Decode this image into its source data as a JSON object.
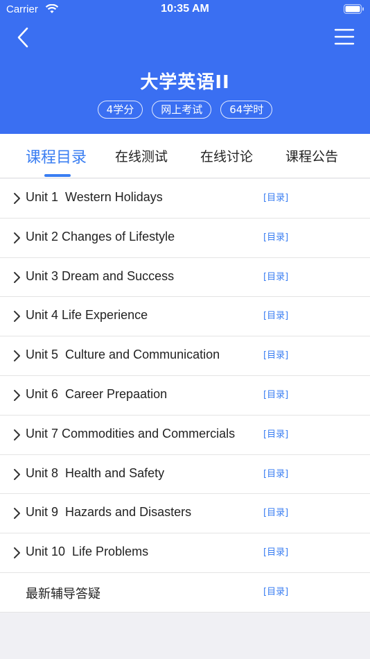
{
  "status_bar": {
    "carrier": "Carrier",
    "time": "10:35 AM"
  },
  "header": {
    "title": "大学英语II",
    "tags": [
      "4学分",
      "网上考试",
      "64学时"
    ],
    "color": "#3a6ff2"
  },
  "tabs": [
    {
      "label": "课程目录",
      "active": true
    },
    {
      "label": "在线测试",
      "active": false
    },
    {
      "label": "在线讨论",
      "active": false
    },
    {
      "label": "课程公告",
      "active": false
    }
  ],
  "units": [
    {
      "title": "Unit 1  Western Holidays",
      "link": "[目录]",
      "expandable": true
    },
    {
      "title": "Unit 2 Changes of Lifestyle",
      "link": "[目录]",
      "expandable": true
    },
    {
      "title": "Unit 3 Dream and Success",
      "link": "[目录]",
      "expandable": true
    },
    {
      "title": "Unit 4 Life Experience",
      "link": "[目录]",
      "expandable": true
    },
    {
      "title": "Unit 5  Culture and Communication",
      "link": "[目录]",
      "expandable": true
    },
    {
      "title": "Unit 6  Career Prepaation",
      "link": "[目录]",
      "expandable": true
    },
    {
      "title": "Unit 7 Commodities and Commercials",
      "link": "[目录]",
      "expandable": true
    },
    {
      "title": "Unit 8  Health and Safety",
      "link": "[目录]",
      "expandable": true
    },
    {
      "title": "Unit 9  Hazards and Disasters",
      "link": "[目录]",
      "expandable": true
    },
    {
      "title": "Unit 10  Life Problems",
      "link": "[目录]",
      "expandable": true
    },
    {
      "title": "最新辅导答疑",
      "link": "[目录]",
      "expandable": false
    }
  ],
  "icons": {
    "back": "back-chevron-icon",
    "menu": "hamburger-menu-icon",
    "row_expand": "chevron-right-icon"
  },
  "accent_color": "#3a7ef2"
}
